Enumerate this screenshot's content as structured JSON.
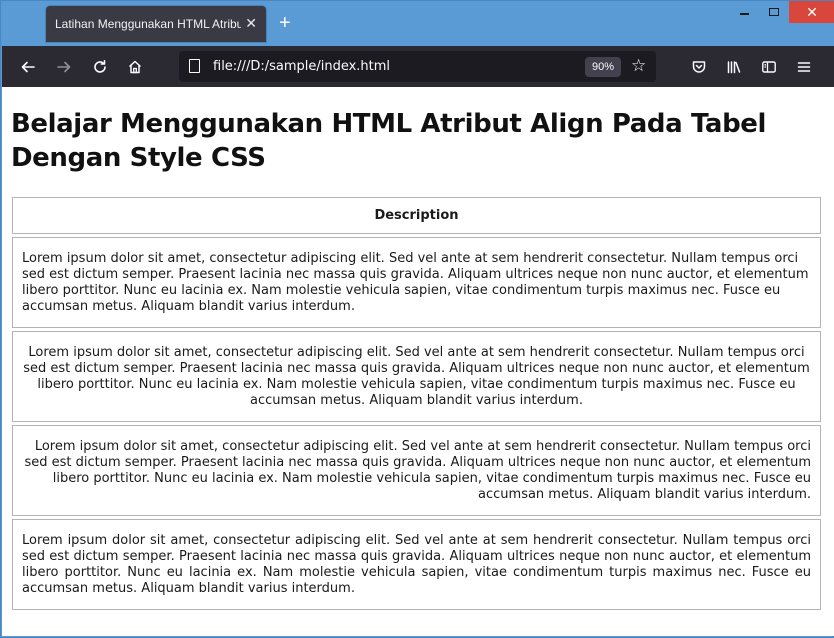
{
  "window": {
    "tab_title": "Latihan Menggunakan HTML Atribut Align",
    "tab_close_icon": "close-icon",
    "new_tab_icon": "plus-icon"
  },
  "toolbar": {
    "url": "file:///D:/sample/index.html",
    "zoom": "90%"
  },
  "page": {
    "heading": "Belajar Menggunakan HTML Atribut Align Pada Tabel Dengan Style CSS",
    "table": {
      "header": "Description",
      "rows": [
        {
          "align": "left",
          "text": "Lorem ipsum dolor sit amet, consectetur adipiscing elit. Sed vel ante at sem hendrerit consectetur. Nullam tempus orci sed est dictum semper. Praesent lacinia nec massa quis gravida. Aliquam ultrices neque non nunc auctor, et elementum libero porttitor. Nunc eu lacinia ex. Nam molestie vehicula sapien, vitae condimentum turpis maximus nec. Fusce eu accumsan metus. Aliquam blandit varius interdum."
        },
        {
          "align": "center",
          "text": "Lorem ipsum dolor sit amet, consectetur adipiscing elit. Sed vel ante at sem hendrerit consectetur. Nullam tempus orci sed est dictum semper. Praesent lacinia nec massa quis gravida. Aliquam ultrices neque non nunc auctor, et elementum libero porttitor. Nunc eu lacinia ex. Nam molestie vehicula sapien, vitae condimentum turpis maximus nec. Fusce eu accumsan metus. Aliquam blandit varius interdum."
        },
        {
          "align": "right",
          "text": "Lorem ipsum dolor sit amet, consectetur adipiscing elit. Sed vel ante at sem hendrerit consectetur. Nullam tempus orci sed est dictum semper. Praesent lacinia nec massa quis gravida. Aliquam ultrices neque non nunc auctor, et elementum libero porttitor. Nunc eu lacinia ex. Nam molestie vehicula sapien, vitae condimentum turpis maximus nec. Fusce eu accumsan metus. Aliquam blandit varius interdum."
        },
        {
          "align": "justify",
          "text": "Lorem ipsum dolor sit amet, consectetur adipiscing elit. Sed vel ante at sem hendrerit consectetur. Nullam tempus orci sed est dictum semper. Praesent lacinia nec massa quis gravida. Aliquam ultrices neque non nunc auctor, et elementum libero porttitor. Nunc eu lacinia ex. Nam molestie vehicula sapien, vitae condimentum turpis maximus nec. Fusce eu accumsan metus. Aliquam blandit varius interdum."
        }
      ]
    }
  },
  "colors": {
    "titlebar": "#5b9bd5",
    "toolbar": "#2b2a33",
    "urlbar": "#1c1b22",
    "close_button": "#d9463c"
  }
}
